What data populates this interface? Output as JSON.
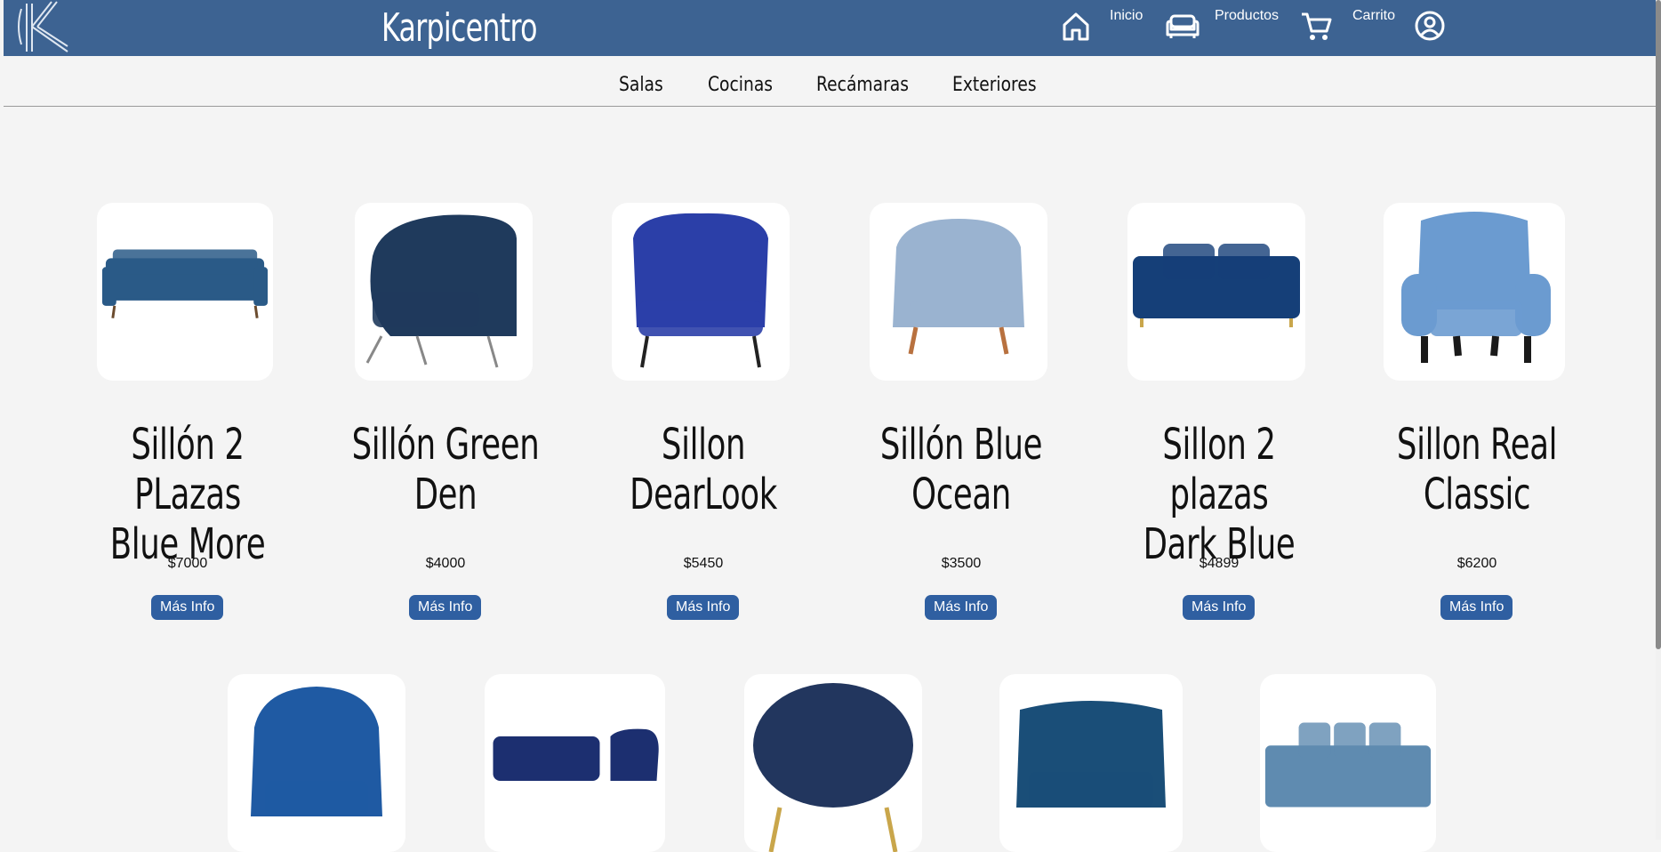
{
  "header": {
    "brand": "Karpicentro",
    "nav": [
      {
        "label": "Inicio",
        "icon": "home-icon"
      },
      {
        "label": "Productos",
        "icon": "sofa-icon"
      },
      {
        "label": "Carrito",
        "icon": "cart-icon"
      },
      {
        "label": "",
        "icon": "user-account-icon"
      }
    ]
  },
  "subnav": [
    "Salas",
    "Cocinas",
    "Recámaras",
    "Exteriores"
  ],
  "products": [
    {
      "name_line1": "Sillón 2 PLazas",
      "name_line2": "Blue More",
      "price": "$7000",
      "button": "Más Info",
      "color": "#2a5a87"
    },
    {
      "name_line1": "Sillón Green",
      "name_line2": "Den",
      "price": "$4000",
      "button": "Más Info",
      "color": "#1f3a5c"
    },
    {
      "name_line1": "Sillon",
      "name_line2": "DearLook",
      "price": "$5450",
      "button": "Más Info",
      "color": "#2b3fa8"
    },
    {
      "name_line1": "Sillón Blue",
      "name_line2": "Ocean",
      "price": "$3500",
      "button": "Más Info",
      "color": "#9ab3d0"
    },
    {
      "name_line1": "Sillon 2 plazas",
      "name_line2": "Dark Blue",
      "price": "$4899",
      "button": "Más Info",
      "color": "#153f78"
    },
    {
      "name_line1": "Sillon Real",
      "name_line2": "Classic",
      "price": "$6200",
      "button": "Más Info",
      "color": "#6b9bd0"
    }
  ],
  "second_row_colors": [
    "#1f5aa3",
    "#1c2f70",
    "#22365e",
    "#1a4e78",
    "#5f8bb0"
  ],
  "colors": {
    "header": "#3d6392",
    "button": "#2f5fa1",
    "background": "#f4f4f4"
  }
}
